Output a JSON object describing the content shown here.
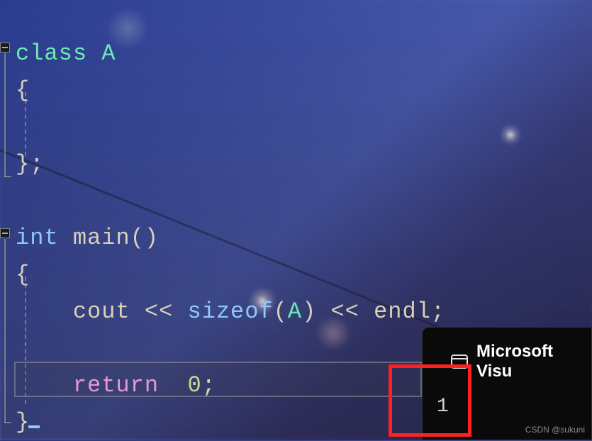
{
  "code": {
    "line1": {
      "keyword": "class",
      "name": "A"
    },
    "line2": {
      "brace": "{"
    },
    "line3": {
      "brace": "};"
    },
    "line4": {
      "keyword": "int",
      "name": "main",
      "parens": "()"
    },
    "line5": {
      "brace": "{"
    },
    "line6": {
      "ident1": "cout",
      "op1": "<<",
      "keyword": "sizeof",
      "lparen": "(",
      "type": "A",
      "rparen": ")",
      "op2": "<<",
      "ident2": "endl",
      "semi": ";"
    },
    "line7": {
      "keyword": "return",
      "value": "0",
      "semi": ";"
    },
    "line8": {
      "brace": "}"
    }
  },
  "output": {
    "title": "Microsoft Visu",
    "value": "1"
  },
  "watermark": "CSDN @sukuni"
}
